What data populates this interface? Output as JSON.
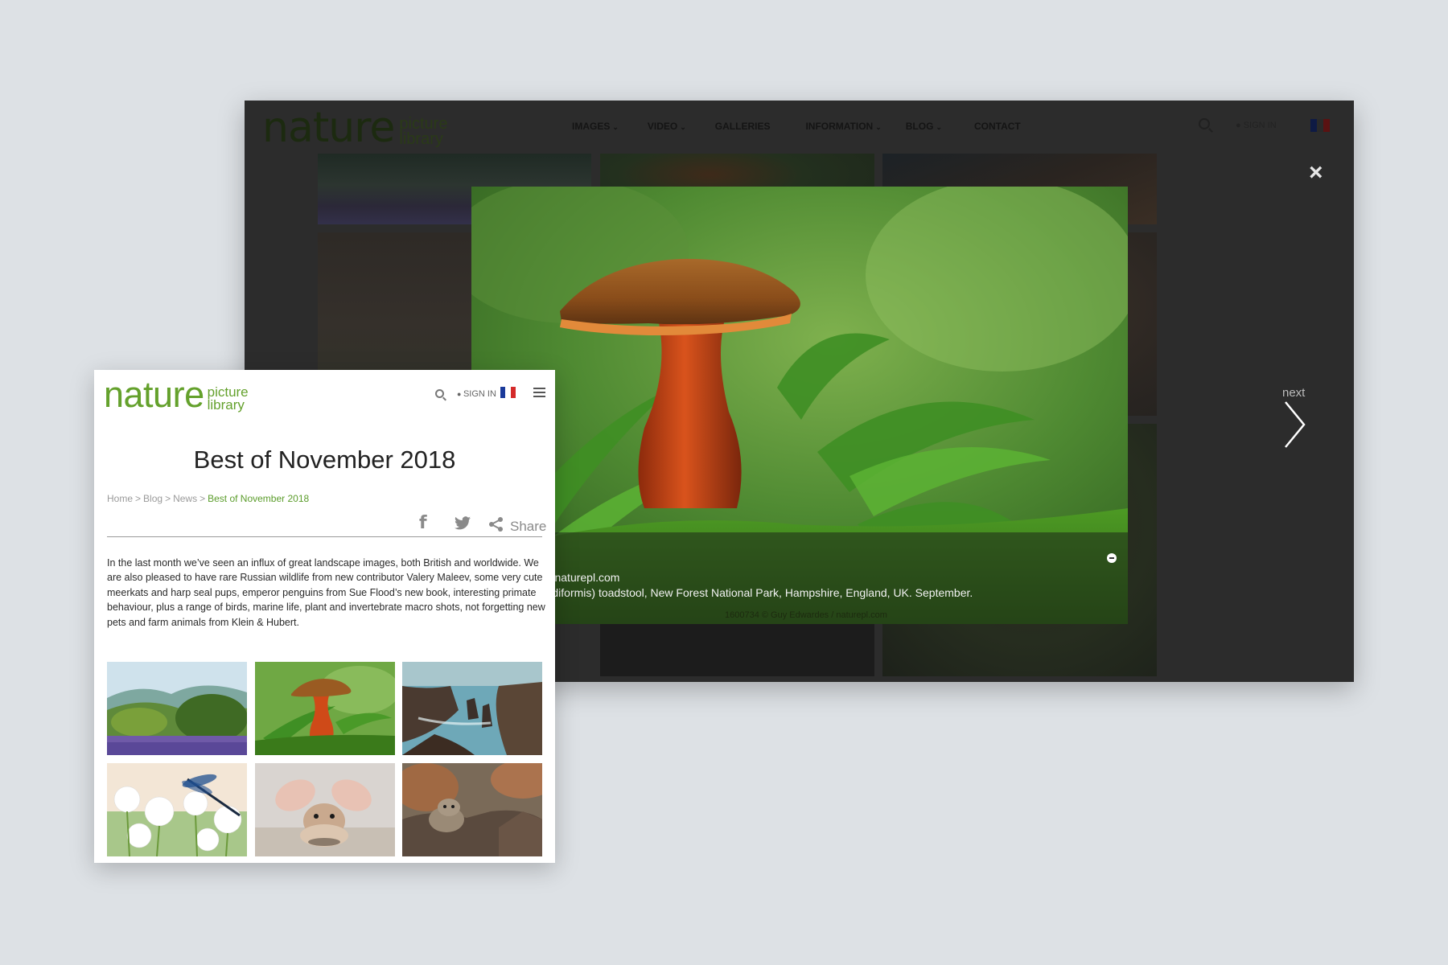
{
  "desktop": {
    "logo": {
      "word": "nature",
      "line1": "picture",
      "line2": "library"
    },
    "nav": [
      {
        "label": "IMAGES",
        "has_dropdown": true
      },
      {
        "label": "VIDEO",
        "has_dropdown": true
      },
      {
        "label": "GALLERIES",
        "has_dropdown": false
      },
      {
        "label": "INFORMATION",
        "has_dropdown": true
      },
      {
        "label": "BLOG",
        "has_dropdown": true
      },
      {
        "label": "CONTACT",
        "has_dropdown": false
      }
    ],
    "signin": "SIGN IN",
    "lightbox": {
      "next_label": "next",
      "credit": "Guy Edwardes / naturepl.com",
      "description": "lete (Boletus luridiformis) toadstool, New Forest National Park, Hampshire, England, UK. September.",
      "watermark": "1600734 © Guy Edwardes / naturepl.com"
    }
  },
  "mobile": {
    "logo": {
      "word": "nature",
      "line1": "picture",
      "line2": "library"
    },
    "signin": "SIGN IN",
    "title": "Best of November 2018",
    "breadcrumb": {
      "home": "Home",
      "blog": "Blog",
      "news": "News",
      "current": "Best of November 2018"
    },
    "share_label": "Share",
    "body": "In the last month we’ve seen an influx of great landscape images, both British and worldwide. We are also pleased to have rare Russian wildlife from new contributor Valery Maleev, some very cute meerkats and harp seal pups, emperor penguins from Sue Flood’s new book, interesting primate behaviour, plus a range of birds, marine life, plant and invertebrate macro shots, not forgetting new pets and farm animals from Klein & Hubert."
  },
  "colors": {
    "brand_green": "#64a12c",
    "flag_blue": "#1a3a9a",
    "flag_red": "#d42a2a",
    "backdrop": "#dde1e5",
    "overlay": "#2c2c2c"
  },
  "icons": [
    "search-icon",
    "user-icon",
    "french-flag-icon",
    "menu-icon",
    "close-icon",
    "chevron-right-icon",
    "facebook-icon",
    "twitter-icon",
    "share-icon",
    "collapse-icon"
  ]
}
